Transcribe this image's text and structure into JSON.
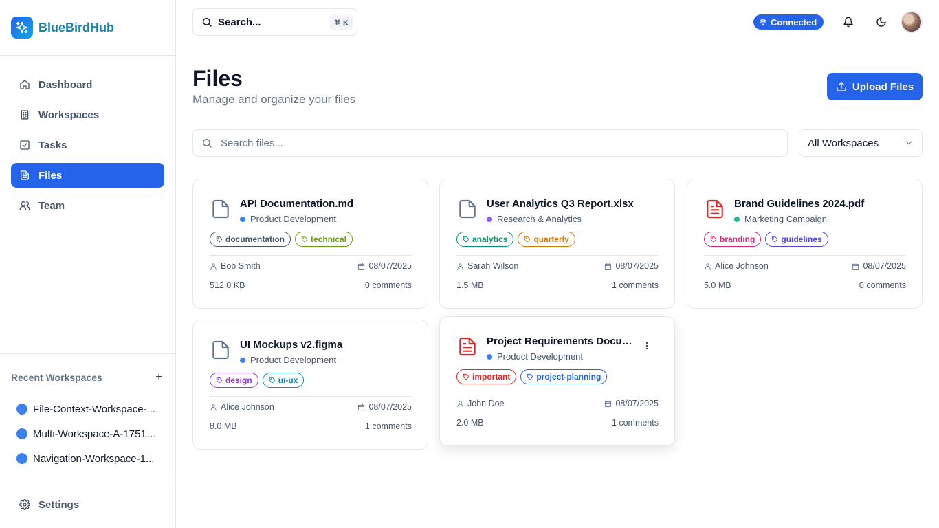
{
  "app": {
    "name": "BlueBirdHub"
  },
  "sidebar": {
    "nav": [
      {
        "label": "Dashboard",
        "icon": "home-icon",
        "active": false
      },
      {
        "label": "Workspaces",
        "icon": "building-icon",
        "active": false
      },
      {
        "label": "Tasks",
        "icon": "checkbox-icon",
        "active": false
      },
      {
        "label": "Files",
        "icon": "file-text-icon",
        "active": true
      },
      {
        "label": "Team",
        "icon": "users-icon",
        "active": false
      }
    ],
    "recent_title": "Recent Workspaces",
    "recent_add": "+",
    "recent": [
      {
        "label": "File-Context-Workspace-..."
      },
      {
        "label": "Multi-Workspace-A-17519..."
      },
      {
        "label": "Navigation-Workspace-1..."
      }
    ],
    "settings_label": "Settings"
  },
  "topbar": {
    "search_label": "Search...",
    "shortcut": "⌘ K",
    "status": "Connected"
  },
  "header": {
    "title": "Files",
    "subtitle": "Manage and organize your files",
    "upload_label": "Upload Files"
  },
  "filters": {
    "search_placeholder": "Search files...",
    "workspace_select": "All Workspaces"
  },
  "colors": {
    "primary": "#2563eb",
    "brand_text": "#1e7fa8"
  },
  "files": [
    {
      "name": "API Documentation.md",
      "icon": "file-icon",
      "icon_color": "#64748b",
      "workspace": "Product Development",
      "workspace_color": "#3b82f6",
      "tags": [
        {
          "label": "documentation",
          "color": "#475569"
        },
        {
          "label": "technical",
          "color": "#65a30d"
        }
      ],
      "owner": "Bob Smith",
      "date": "08/07/2025",
      "size": "512.0 KB",
      "comments": "0 comments"
    },
    {
      "name": "User Analytics Q3 Report.xlsx",
      "icon": "file-icon",
      "icon_color": "#64748b",
      "workspace": "Research & Analytics",
      "workspace_color": "#8b5cf6",
      "tags": [
        {
          "label": "analytics",
          "color": "#059669"
        },
        {
          "label": "quarterly",
          "color": "#d97706"
        }
      ],
      "owner": "Sarah Wilson",
      "date": "08/07/2025",
      "size": "1.5 MB",
      "comments": "1 comments"
    },
    {
      "name": "Brand Guidelines 2024.pdf",
      "icon": "file-text-icon",
      "icon_color": "#dc2626",
      "workspace": "Marketing Campaign",
      "workspace_color": "#10b981",
      "tags": [
        {
          "label": "branding",
          "color": "#db2777"
        },
        {
          "label": "guidelines",
          "color": "#4f46e5"
        }
      ],
      "owner": "Alice Johnson",
      "date": "08/07/2025",
      "size": "5.0 MB",
      "comments": "0 comments"
    },
    {
      "name": "UI Mockups v2.figma",
      "icon": "file-icon",
      "icon_color": "#64748b",
      "workspace": "Product Development",
      "workspace_color": "#3b82f6",
      "tags": [
        {
          "label": "design",
          "color": "#9333ea"
        },
        {
          "label": "ui-ux",
          "color": "#0891b2"
        }
      ],
      "owner": "Alice Johnson",
      "date": "08/07/2025",
      "size": "8.0 MB",
      "comments": "1 comments"
    },
    {
      "name": "Project Requirements Document",
      "icon": "file-text-icon",
      "icon_color": "#dc2626",
      "workspace": "Product Development",
      "workspace_color": "#3b82f6",
      "tags": [
        {
          "label": "important",
          "color": "#dc2626"
        },
        {
          "label": "project-planning",
          "color": "#2563eb"
        }
      ],
      "owner": "John Doe",
      "date": "08/07/2025",
      "size": "2.0 MB",
      "comments": "1 comments",
      "hovered": true
    }
  ]
}
